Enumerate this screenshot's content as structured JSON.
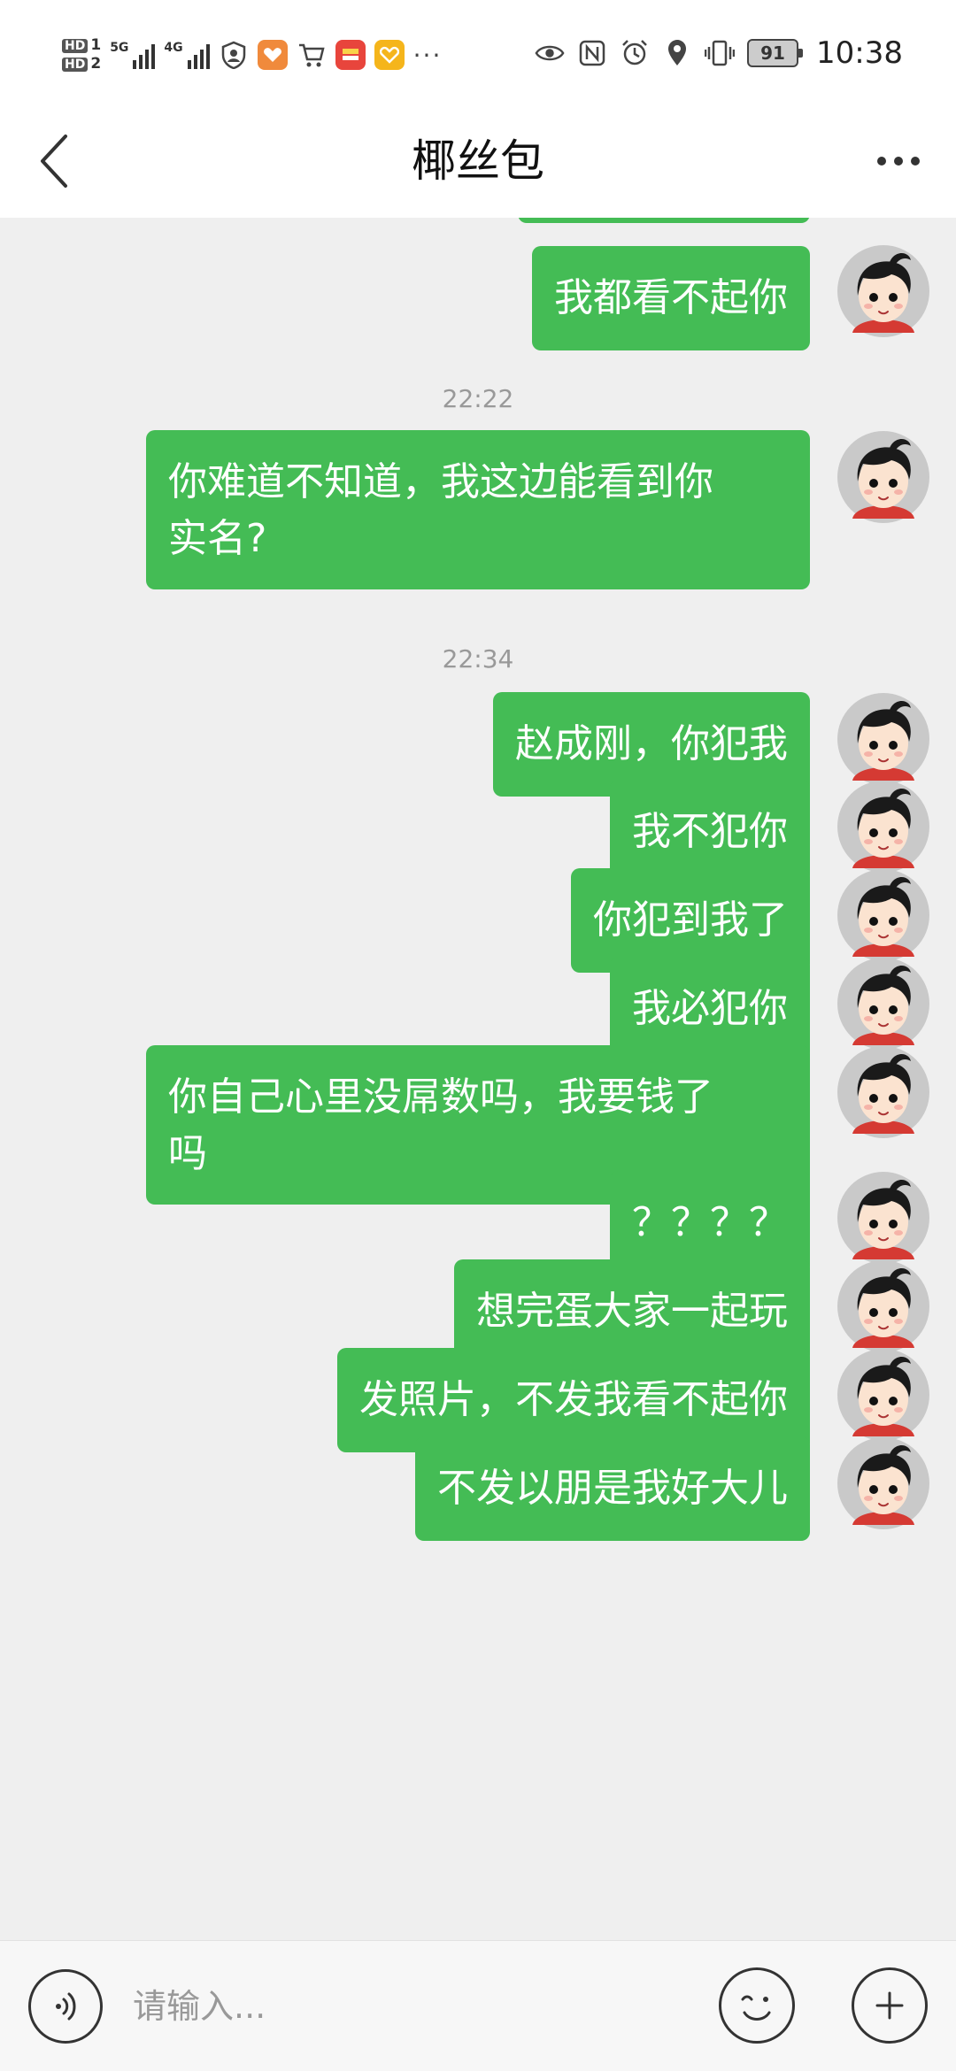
{
  "status_bar": {
    "hd1": "HD",
    "hd1_num": "1",
    "hd2": "HD",
    "hd2_num": "2",
    "net1": "5G",
    "net2": "4G",
    "more": "···",
    "battery": "91",
    "time": "10:38"
  },
  "header": {
    "title": "椰丝包"
  },
  "messages": [
    {
      "type": "text",
      "text": "我都看不起你"
    },
    {
      "type": "time",
      "text": "22:22"
    },
    {
      "type": "text",
      "lines": [
        "你难道不知道，我这边能看到你",
        "实名?"
      ]
    },
    {
      "type": "time",
      "text": "22:34"
    },
    {
      "type": "text",
      "text": "赵成刚，你犯我"
    },
    {
      "type": "text",
      "text": "我不犯你"
    },
    {
      "type": "text",
      "text": "你犯到我了"
    },
    {
      "type": "text",
      "text": "我必犯你"
    },
    {
      "type": "text",
      "lines": [
        "你自己心里没屌数吗，我要钱了",
        "吗"
      ]
    },
    {
      "type": "text",
      "text": "？？？？"
    },
    {
      "type": "text",
      "text": "想完蛋大家一起玩"
    },
    {
      "type": "text",
      "text": "发照片，不发我看不起你"
    },
    {
      "type": "text",
      "text": "不发以朋是我好大儿"
    }
  ],
  "input_bar": {
    "placeholder": "请输入..."
  },
  "colors": {
    "bubble": "#44bc55",
    "background": "#efefef"
  },
  "icons": [
    "back-arrow-icon",
    "more-dots-icon",
    "voice-icon",
    "emoji-icon",
    "plus-icon",
    "avatar"
  ]
}
